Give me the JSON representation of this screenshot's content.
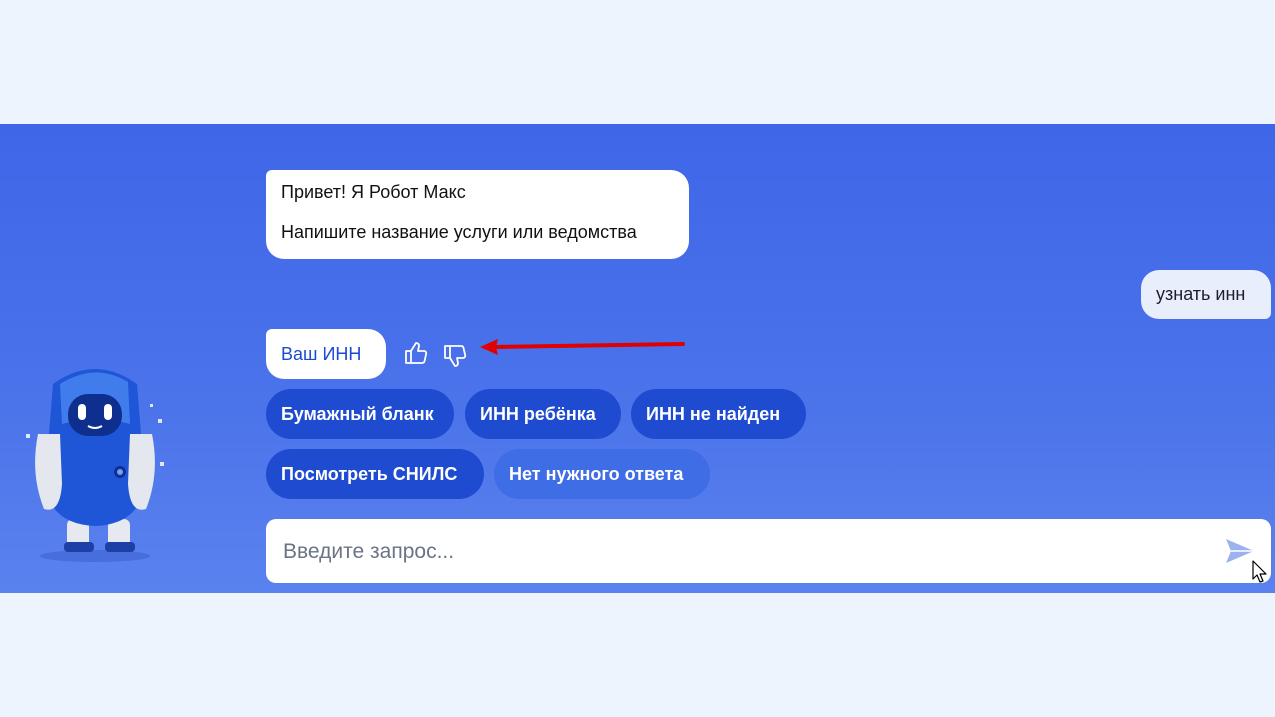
{
  "chat": {
    "bot_greeting": {
      "line1": "Привет! Я Робот Макс",
      "line2": "Напишите название услуги или ведомства"
    },
    "user_message": "узнать инн",
    "bot_answer": "Ваш ИНН",
    "feedback": {
      "like_icon": "thumbs-up-icon",
      "dislike_icon": "thumbs-down-icon"
    },
    "suggestions": [
      {
        "label": "Бумажный бланк"
      },
      {
        "label": "ИНН ребёнка"
      },
      {
        "label": "ИНН не найден"
      },
      {
        "label": "Посмотреть СНИЛС"
      },
      {
        "label": "Нет нужного ответа"
      }
    ]
  },
  "input": {
    "placeholder": "Введите запрос...",
    "value": ""
  },
  "icons": {
    "send": "send-icon",
    "annotation": "red-arrow",
    "mascot": "robot-max-mascot"
  },
  "colors": {
    "page_bg": "#eef4fd",
    "panel_bg": "#4a72ea",
    "chip_dark": "#1e4bd0",
    "chip_light": "#3f6de6",
    "link_blue": "#1a4bd3",
    "arrow_red": "#e00000"
  }
}
